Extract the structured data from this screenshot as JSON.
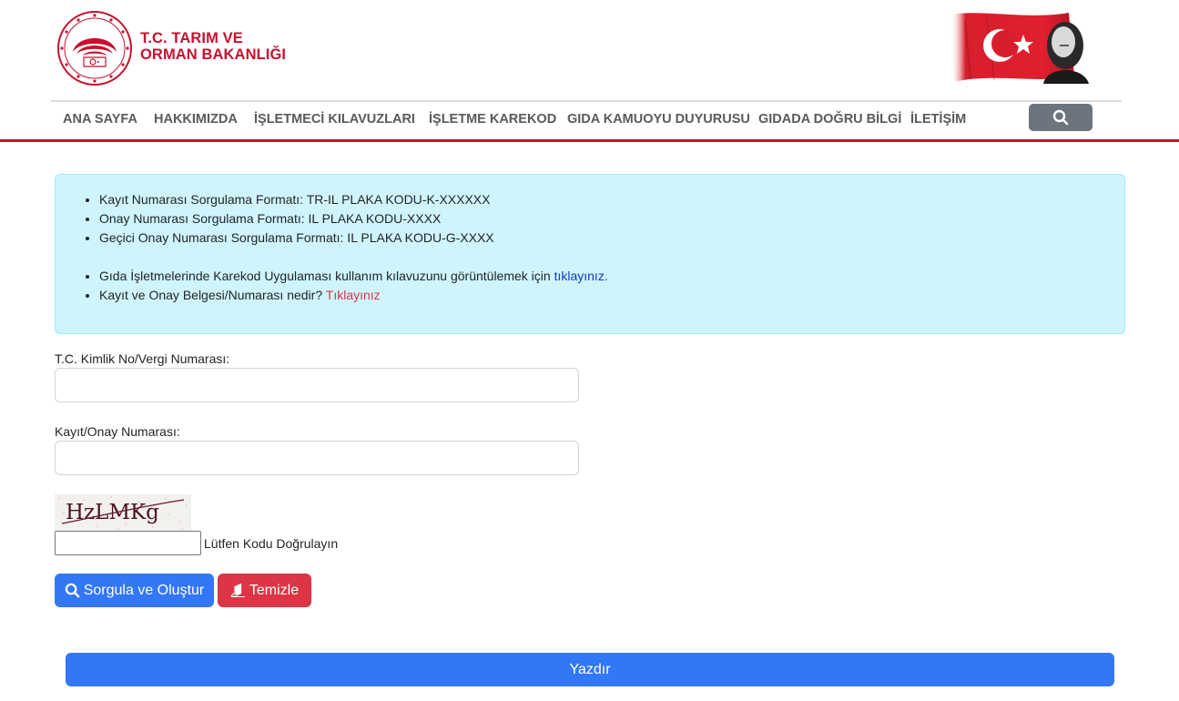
{
  "header": {
    "brand_line1": "T.C. TARIM VE",
    "brand_line2": "ORMAN BAKANLIĞI",
    "logo_icon": "ministry-logo-icon",
    "flag_icon": "turkish-flag-portrait-icon"
  },
  "nav": {
    "items": [
      {
        "label": "ANA SAYFA"
      },
      {
        "label": "HAKKIMIZDA"
      },
      {
        "label": "İŞLETMECİ KILAVUZLARI"
      },
      {
        "label": "İŞLETME KAREKOD"
      },
      {
        "label": "GIDA KAMUOYU DUYURUSU"
      },
      {
        "label": "GIDADA DOĞRU BİLGİ"
      },
      {
        "label": "İLETİŞİM"
      }
    ],
    "search_icon": "search-icon"
  },
  "info": {
    "line1": "Kayıt Numarası Sorgulama Formatı: TR-IL PLAKA KODU-K-XXXXXX",
    "line2": "Onay Numarası Sorgulama Formatı: IL PLAKA KODU-XXXX",
    "line3": "Geçici Onay Numarası Sorgulama Formatı: IL PLAKA KODU-G-XXXX",
    "line4_text": "Gıda İşletmelerinde Karekod Uygulaması kullanım kılavuzunu görüntülemek için ",
    "line4_link": "tıklayınız.",
    "line5_text": "Kayıt ve Onay Belgesi/Numarası nedir? ",
    "line5_link": "Tıklayınız"
  },
  "form": {
    "tc_label": "T.C. Kimlik No/Vergi Numarası:",
    "tc_value": "",
    "kayit_label": "Kayıt/Onay Numarası:",
    "kayit_value": "",
    "captcha_text": "HzLMKg",
    "captcha_value": "",
    "captcha_label": "Lütfen Kodu Doğrulayın",
    "submit_label": "Sorgula ve Oluştur",
    "clear_label": "Temizle",
    "print_label": "Yazdır"
  },
  "colors": {
    "brand_red": "#c8102e",
    "primary_blue": "#3377f7",
    "danger_red": "#dc3545",
    "info_bg": "#cff4fc"
  }
}
